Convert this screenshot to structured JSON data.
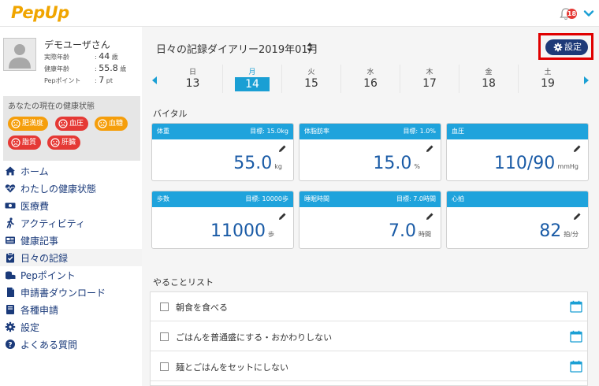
{
  "header": {
    "logo": "PepUp",
    "notification_count": "18"
  },
  "user": {
    "name": "デモユーザさん",
    "stats": [
      {
        "label": "実際年齢",
        "value": "44",
        "unit": "歳"
      },
      {
        "label": "健康年齢",
        "value": "55.8",
        "unit": "歳"
      },
      {
        "label": "Pepポイント",
        "value": "7",
        "unit": "pt"
      }
    ]
  },
  "health": {
    "title": "あなたの現在の健康状態",
    "tags": [
      {
        "label": "肥満度",
        "color": "orange"
      },
      {
        "label": "血圧",
        "color": "red"
      },
      {
        "label": "血糖",
        "color": "orange"
      },
      {
        "label": "脂質",
        "color": "red"
      },
      {
        "label": "肝臓",
        "color": "red"
      }
    ]
  },
  "nav": [
    {
      "label": "ホーム",
      "icon": "home-icon"
    },
    {
      "label": "わたしの健康状態",
      "icon": "heartbeat-icon"
    },
    {
      "label": "医療費",
      "icon": "money-icon"
    },
    {
      "label": "アクティビティ",
      "icon": "walking-icon"
    },
    {
      "label": "健康記事",
      "icon": "newspaper-icon"
    },
    {
      "label": "日々の記録",
      "icon": "clipboard-icon",
      "active": true
    },
    {
      "label": "Pepポイント",
      "icon": "coins-icon"
    },
    {
      "label": "申請書ダウンロード",
      "icon": "file-icon"
    },
    {
      "label": "各種申請",
      "icon": "book-icon"
    },
    {
      "label": "設定",
      "icon": "gear-icon"
    },
    {
      "label": "よくある質問",
      "icon": "question-icon"
    }
  ],
  "diary": {
    "title": "日々の記録ダイアリー2019年01月",
    "settings_label": "設定"
  },
  "week": [
    {
      "dow": "日",
      "date": "13"
    },
    {
      "dow": "月",
      "date": "14",
      "active": true
    },
    {
      "dow": "火",
      "date": "15"
    },
    {
      "dow": "水",
      "date": "16"
    },
    {
      "dow": "木",
      "date": "17"
    },
    {
      "dow": "金",
      "date": "18"
    },
    {
      "dow": "土",
      "date": "19"
    }
  ],
  "vitals": {
    "label": "バイタル",
    "cards": [
      {
        "title": "体重",
        "goal": "目標: 15.0kg",
        "value": "55.0",
        "unit": "kg"
      },
      {
        "title": "体脂肪率",
        "goal": "目標: 1.0%",
        "value": "15.0",
        "unit": "%"
      },
      {
        "title": "血圧",
        "goal": "",
        "value": "110/90",
        "unit": "mmHg"
      },
      {
        "title": "歩数",
        "goal": "目標: 10000歩",
        "value": "11000",
        "unit": "歩"
      },
      {
        "title": "睡眠時間",
        "goal": "目標: 7.0時間",
        "value": "7.0",
        "unit": "時間"
      },
      {
        "title": "心拍",
        "goal": "",
        "value": "82",
        "unit": "拍/分"
      }
    ]
  },
  "todo": {
    "label": "やることリスト",
    "items": [
      "朝食を食べる",
      "ごはんを普通盛にする・おかわりしない",
      "麺とごはんをセットにしない"
    ]
  }
}
